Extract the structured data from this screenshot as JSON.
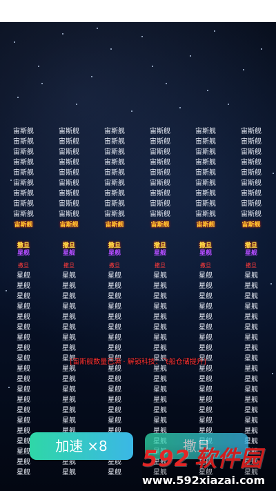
{
  "grid": {
    "columns": 6,
    "upper_label": "宙斯舰",
    "upper_rows": 9,
    "tags": {
      "a": "宙斯舰",
      "b": "撒旦",
      "c": "星舰",
      "d": "撒旦"
    },
    "lower_label": "星舰",
    "lower_rows": 20
  },
  "banner": "[宙斯舰数量已满 · 解锁科技：飞船仓储提升]",
  "buttons": {
    "speed_label": "加速",
    "speed_multiplier": "×8",
    "withdraw_label": "撒旦"
  },
  "watermark": {
    "number": "592",
    "text": "软件园",
    "url": "www.592xiazai.com"
  },
  "colors": {
    "background": "#050b18",
    "ship_text": "#e8ecf5",
    "banner": "#ff3030",
    "button_gradient_start": "#2fd7a7",
    "button_gradient_end": "#3bb7e6"
  }
}
